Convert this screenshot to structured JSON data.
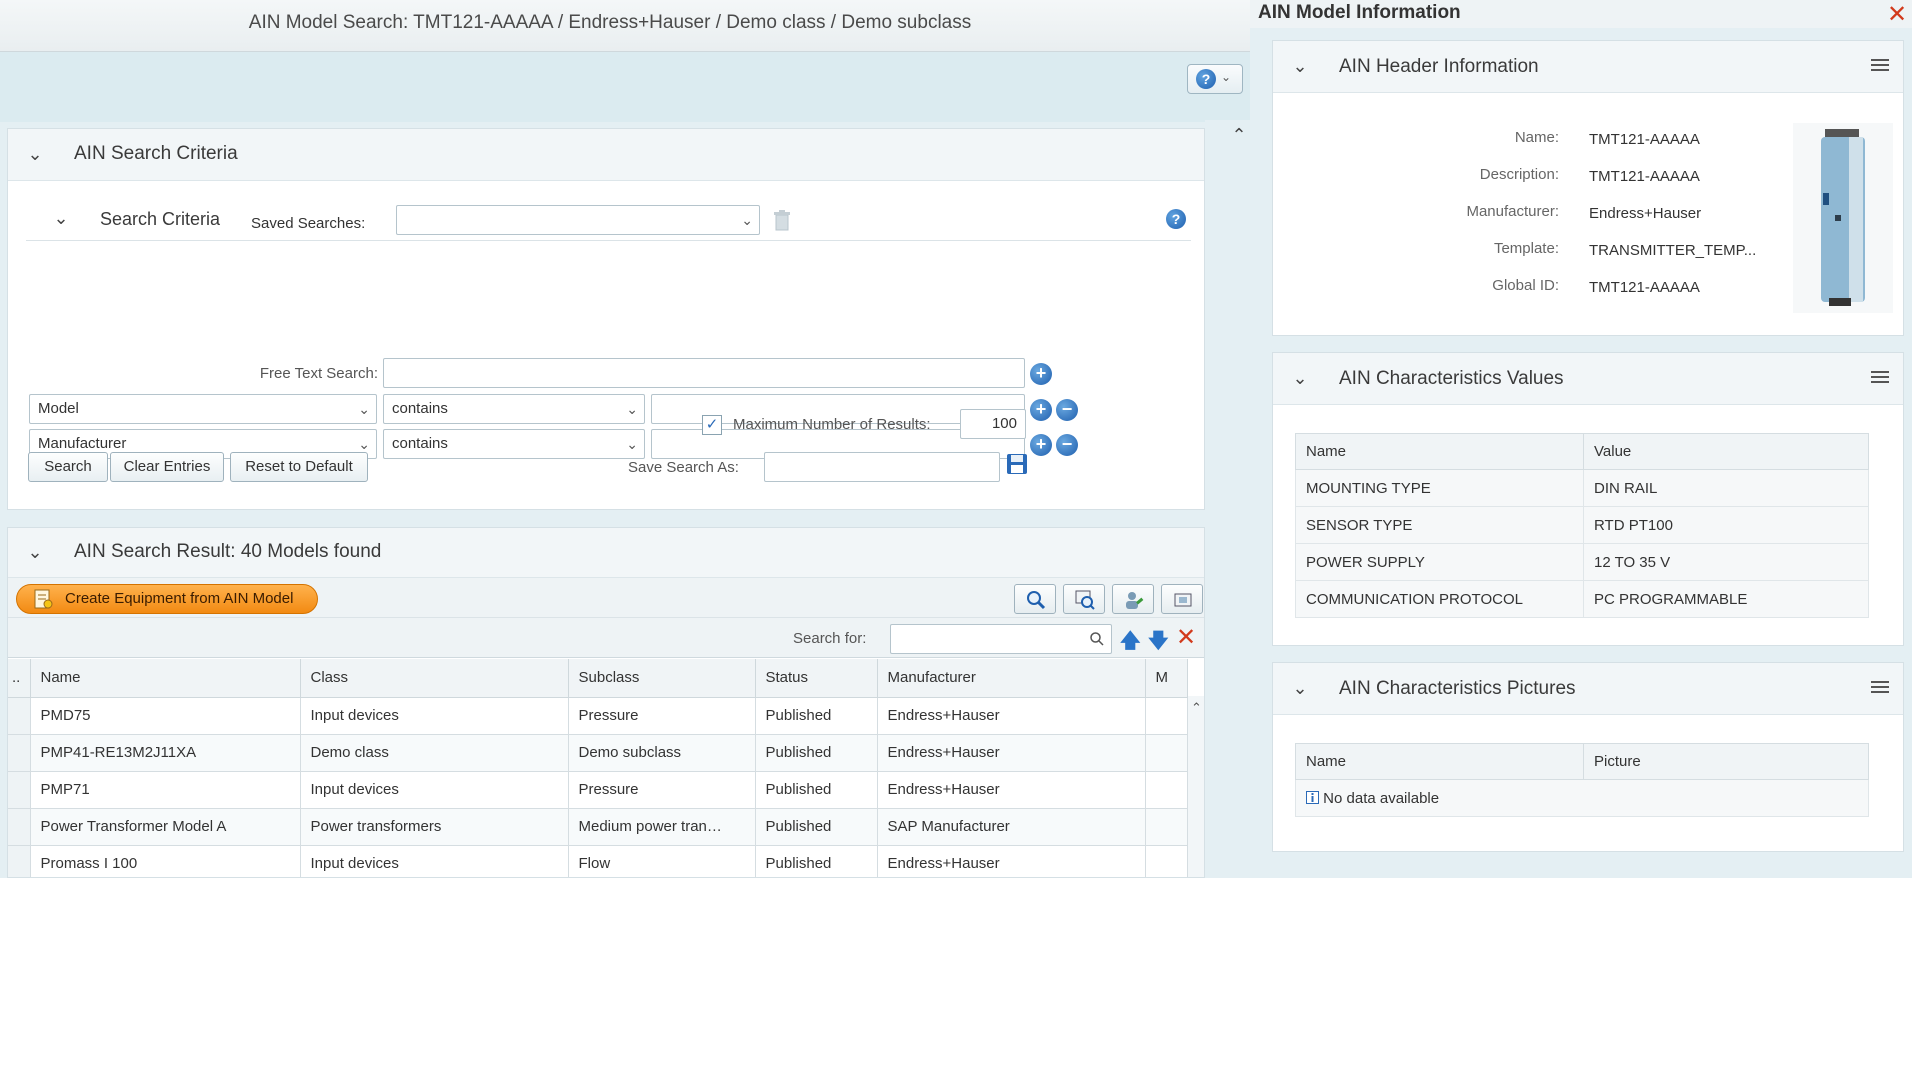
{
  "left_window": {
    "title": "AIN Model Search: TMT121-AAAAA / Endress+Hauser / Demo class / Demo subclass"
  },
  "criteria_panel": {
    "title": "AIN Search Criteria",
    "sub_title": "Search Criteria",
    "saved_searches_label": "Saved Searches:",
    "saved_searches_value": "",
    "free_text_label": "Free Text Search:",
    "free_text_value": "",
    "rows": [
      {
        "field": "Model",
        "operator": "contains",
        "value": ""
      },
      {
        "field": "Manufacturer",
        "operator": "contains",
        "value": ""
      }
    ],
    "max_results_label": "Maximum Number of Results:",
    "max_results_checked": true,
    "max_results_value": "100",
    "buttons": {
      "search": "Search",
      "clear": "Clear Entries",
      "reset": "Reset to Default"
    },
    "save_search_label": "Save Search As:",
    "save_search_value": ""
  },
  "result_panel": {
    "title": "AIN Search Result: 40 Models found",
    "create_button": "Create Equipment from AIN Model",
    "search_for_label": "Search for:",
    "search_for_value": "",
    "columns": [
      "Name",
      "Class",
      "Subclass",
      "Status",
      "Manufacturer",
      "M"
    ],
    "rows": [
      [
        "PMD75",
        "Input devices",
        "Pressure",
        "Published",
        "Endress+Hauser"
      ],
      [
        "PMP41-RE13M2J11XA",
        "Demo class",
        "Demo subclass",
        "Published",
        "Endress+Hauser"
      ],
      [
        "PMP71",
        "Input devices",
        "Pressure",
        "Published",
        "Endress+Hauser"
      ],
      [
        "Power Transformer Model A",
        "Power transformers",
        "Medium power tran…",
        "Published",
        "SAP Manufacturer"
      ],
      [
        "Promass I 100",
        "Input devices",
        "Flow",
        "Published",
        "Endress+Hauser"
      ]
    ]
  },
  "right_window": {
    "title": "AIN Model Information",
    "header_panel": {
      "title": "AIN Header Information",
      "fields": [
        {
          "label": "Name:",
          "value": "TMT121-AAAAA"
        },
        {
          "label": "Description:",
          "value": "TMT121-AAAAA"
        },
        {
          "label": "Manufacturer:",
          "value": "Endress+Hauser"
        },
        {
          "label": "Template:",
          "value": "TRANSMITTER_TEMP..."
        },
        {
          "label": "Global ID:",
          "value": "TMT121-AAAAA"
        }
      ]
    },
    "char_values_panel": {
      "title": "AIN Characteristics Values",
      "columns": [
        "Name",
        "Value"
      ],
      "rows": [
        [
          "MOUNTING TYPE",
          "DIN RAIL"
        ],
        [
          "SENSOR TYPE",
          "RTD PT100"
        ],
        [
          "POWER SUPPLY",
          "12 TO 35 V"
        ],
        [
          "COMMUNICATION PROTOCOL",
          "PC PROGRAMMABLE"
        ]
      ]
    },
    "char_pictures_panel": {
      "title": "AIN Characteristics Pictures",
      "columns": [
        "Name",
        "Picture"
      ],
      "empty_text": "No data available"
    }
  },
  "icons": {
    "help": "help-icon",
    "chevron": "chevron-down-icon",
    "trash": "trash-icon",
    "plus": "plus-icon",
    "minus": "minus-icon",
    "save": "save-icon",
    "menu": "menu-icon",
    "close": "close-icon"
  },
  "colors": {
    "accent_orange": "#f28a12",
    "close_red": "#d23a1c",
    "icon_blue": "#1f5fae"
  }
}
